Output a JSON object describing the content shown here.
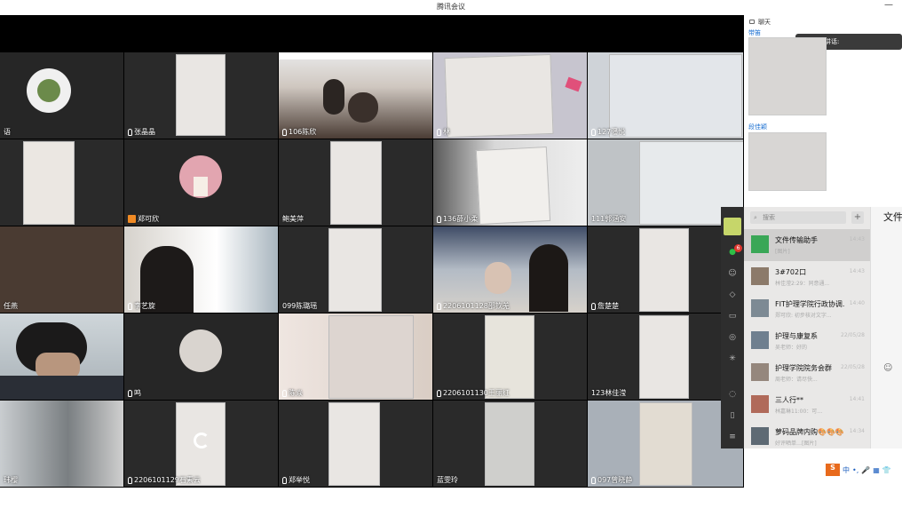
{
  "window": {
    "title": "腾讯会议",
    "minimize_glyph": "—"
  },
  "tiles": [
    {
      "name": "语"
    },
    {
      "name": "张晶晶"
    },
    {
      "name": "106陈欣"
    },
    {
      "name": "林"
    },
    {
      "name": "127潘悦"
    },
    {
      "name": ""
    },
    {
      "name": "郑可欣"
    },
    {
      "name": "鲍美萍"
    },
    {
      "name": "136薛小柔"
    },
    {
      "name": "111郭涵安"
    },
    {
      "name": "任燕"
    },
    {
      "name": "李艺旋"
    },
    {
      "name": "099陈璐瑶"
    },
    {
      "name": "2206101128邵钦羌"
    },
    {
      "name": "詹楚楚"
    },
    {
      "name": ""
    },
    {
      "name": "鸣"
    },
    {
      "name": "陈焱"
    },
    {
      "name": "2206101130王丽红"
    },
    {
      "name": "123林佳滢"
    },
    {
      "name": "玮樱"
    },
    {
      "name": "2206101129石素云"
    },
    {
      "name": "郑举悦"
    },
    {
      "name": "蓝雯玲"
    },
    {
      "name": "097曾晓静"
    }
  ],
  "side_panel": {
    "chat_header": "聊天",
    "speaking_label": "正在讲话:",
    "thumb1_label": "带笛",
    "thumb2_label": "段佳颖"
  },
  "wechat": {
    "search_placeholder": "搜索",
    "plus": "+",
    "main_title": "文件传",
    "chats": [
      {
        "name": "文件传输助手",
        "sub": "[图片]",
        "time": "14:43"
      },
      {
        "name": "3#702口",
        "sub": "林佳滢2:29：同意通...",
        "time": "14:43"
      },
      {
        "name": "FIT护理学院行政协调...",
        "sub": "郑可欣: 初步核对文字...",
        "time": "14:40"
      },
      {
        "name": "护理与康复系",
        "sub": "吴老师：好的",
        "time": "22/05/28"
      },
      {
        "name": "护理学院院务会群",
        "sub": "周老师：请尽快...",
        "time": "22/05/28"
      },
      {
        "name": "三人行**",
        "sub": "林嘉琳11:00：可…",
        "time": "14:41"
      },
      {
        "name": "萝码品牌内购🎨🎨🎨",
        "sub": "好评晒单…[图片]",
        "time": "14:34"
      }
    ],
    "unread_badge": "6"
  },
  "ime": {
    "logo": "S",
    "lang": "中",
    "items": [
      "•,",
      "🎤",
      "▦",
      "👕"
    ]
  }
}
